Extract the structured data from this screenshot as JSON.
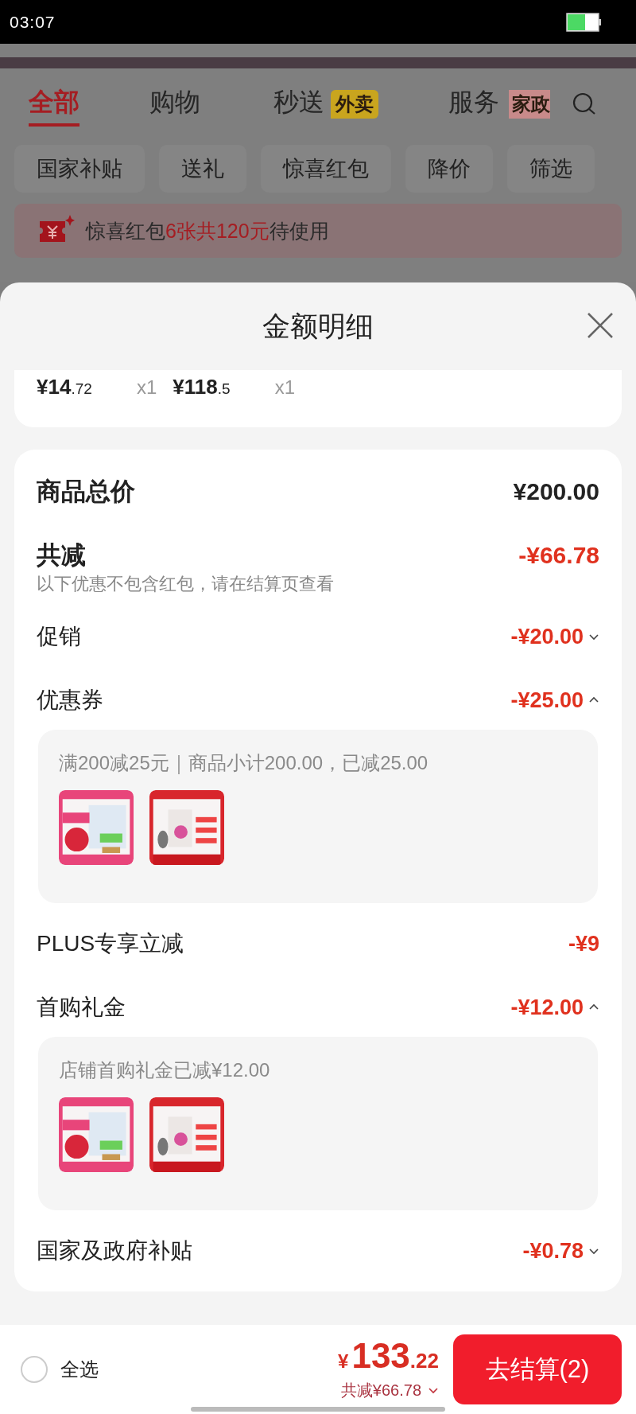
{
  "status_bar": {
    "time": "03:07"
  },
  "background_page": {
    "tabs": [
      {
        "label": "全部",
        "selected": true
      },
      {
        "label": "购物",
        "selected": false
      },
      {
        "label": "秒送",
        "selected": false,
        "badge": {
          "text": "外卖",
          "color": "#c9a51e"
        }
      },
      {
        "label": "服务",
        "selected": false,
        "badge": {
          "text": "家政",
          "color": "#c88a8a"
        }
      }
    ],
    "filters": [
      "国家补贴",
      "送礼",
      "惊喜红包",
      "降价",
      "筛选"
    ],
    "banner": {
      "prefix": "惊喜红包",
      "highlight": "6张共120元",
      "suffix": "待使用"
    }
  },
  "sheet": {
    "title": "金额明细",
    "items": [
      {
        "price": "¥14",
        "decimal": ".72",
        "quantity": "x1"
      },
      {
        "price": "¥118",
        "decimal": ".5",
        "quantity": "x1"
      }
    ],
    "total": {
      "label": "商品总价",
      "value": "¥200.00"
    },
    "reduction": {
      "label": "共减",
      "value": "-¥66.78",
      "note": "以下优惠不包含红包，请在结算页查看"
    },
    "discounts": [
      {
        "label": "促销",
        "value": "-¥20.00",
        "expanded": false
      },
      {
        "label": "优惠券",
        "value": "-¥25.00",
        "expanded": true,
        "detail": "满200减25元｜商品小计200.00，已减25.00"
      },
      {
        "label": "PLUS专享立减",
        "value": "-¥9"
      },
      {
        "label": "首购礼金",
        "value": "-¥12.00",
        "expanded": true,
        "detail": "店铺首购礼金已减¥12.00"
      },
      {
        "label": "国家及政府补贴",
        "value": "-¥0.78",
        "expanded": false
      }
    ]
  },
  "bottom_bar": {
    "select_all": {
      "label": "全选",
      "checked": false
    },
    "currency": "¥",
    "amount": "133",
    "decimal": ".22",
    "reduction": {
      "text": "共减¥66.78",
      "expanded": false
    },
    "checkout": "去结算(2)"
  }
}
